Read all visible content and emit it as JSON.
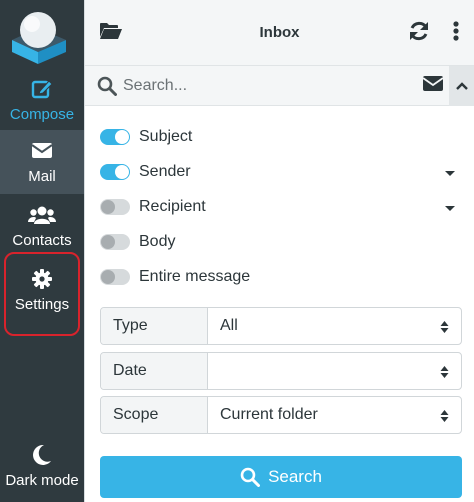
{
  "nav": {
    "compose": "Compose",
    "mail": "Mail",
    "contacts": "Contacts",
    "settings": "Settings",
    "dark_mode": "Dark mode"
  },
  "header": {
    "title": "Inbox"
  },
  "search": {
    "placeholder": "Search..."
  },
  "options": [
    {
      "label": "Subject",
      "enabled": true
    },
    {
      "label": "Sender",
      "enabled": true
    },
    {
      "label": "Recipient",
      "enabled": false
    },
    {
      "label": "Body",
      "enabled": false
    },
    {
      "label": "Entire message",
      "enabled": false
    }
  ],
  "filters": {
    "type": {
      "label": "Type",
      "value": "All"
    },
    "date": {
      "label": "Date",
      "value": ""
    },
    "scope": {
      "label": "Scope",
      "value": "Current folder"
    }
  },
  "search_button": "Search",
  "colors": {
    "sidebar": "#2f3a3f",
    "accent": "#37b4e6",
    "highlight": "#d9232c"
  }
}
